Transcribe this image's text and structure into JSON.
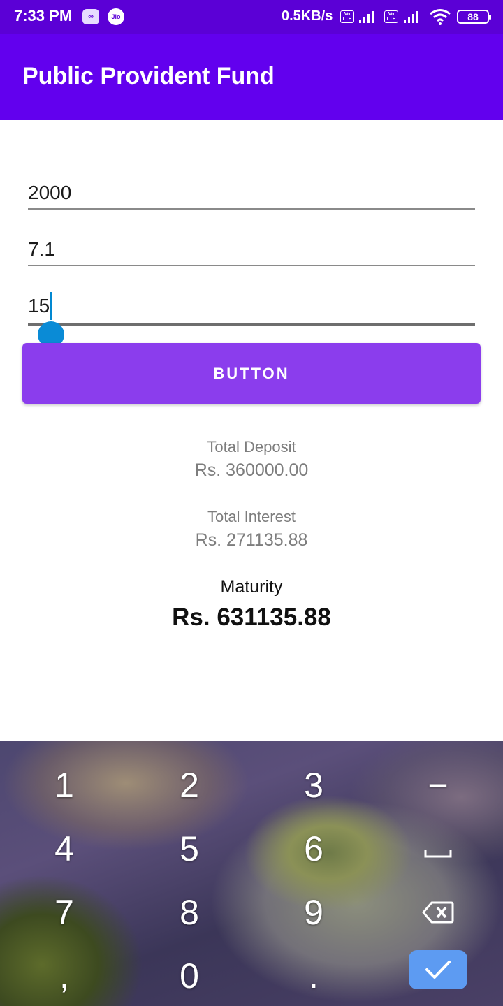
{
  "status_bar": {
    "time": "7:33 PM",
    "net_speed": "0.5KB/s",
    "volte_label": "Vo LTE",
    "jio_label": "Jio",
    "battery": "88",
    "icons": [
      "infinity-icon",
      "jio-icon",
      "volte-icon",
      "signal-icon",
      "wifi-icon",
      "battery-icon"
    ]
  },
  "app_bar": {
    "title": "Public Provident Fund"
  },
  "form": {
    "amount": "2000",
    "rate": "7.1",
    "years": "15",
    "button_label": "BUTTON"
  },
  "results": {
    "deposit_label": "Total Deposit",
    "deposit_value": "Rs. 360000.00",
    "interest_label": "Total Interest",
    "interest_value": "Rs. 271135.88",
    "maturity_label": "Maturity",
    "maturity_value": "Rs. 631135.88"
  },
  "keyboard": {
    "keys": {
      "k1": "1",
      "k2": "2",
      "k3": "3",
      "minus": "−",
      "k4": "4",
      "k5": "5",
      "k6": "6",
      "k7": "7",
      "k8": "8",
      "k9": "9",
      "comma": ",",
      "k0": "0",
      "period": "."
    },
    "icons": [
      "space-icon",
      "backspace-icon",
      "check-icon"
    ]
  },
  "colors": {
    "status_bar": "#5b00d6",
    "app_bar": "#6200ee",
    "button": "#8b3ded",
    "caret": "#0288d1",
    "enter_key": "#5d9bf2"
  }
}
